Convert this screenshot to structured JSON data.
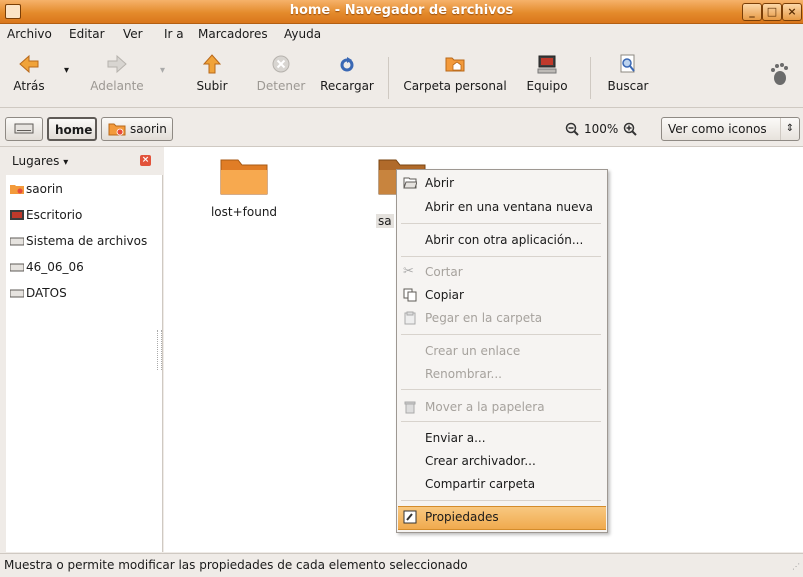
{
  "window": {
    "title": "home - Navegador de archivos"
  },
  "menubar": {
    "items": [
      {
        "label": "Archivo"
      },
      {
        "label": "Editar"
      },
      {
        "label": "Ver"
      },
      {
        "label": "Ir a"
      },
      {
        "label": "Marcadores"
      },
      {
        "label": "Ayuda"
      }
    ]
  },
  "toolbar": {
    "back": "Atrás",
    "forward": "Adelante",
    "up": "Subir",
    "stop": "Detener",
    "reload": "Recargar",
    "home": "Carpeta personal",
    "computer": "Equipo",
    "search": "Buscar"
  },
  "location": {
    "crumbs": [
      "home",
      "saorin"
    ],
    "zoom": "100%",
    "view_mode": "Ver como iconos"
  },
  "sidebar": {
    "header": "Lugares",
    "items": [
      {
        "label": "saorin",
        "icon": "home-folder-icon"
      },
      {
        "label": "Escritorio",
        "icon": "desktop-icon"
      },
      {
        "label": "Sistema de archivos",
        "icon": "drive-icon"
      },
      {
        "label": "46_06_06",
        "icon": "drive-icon"
      },
      {
        "label": "DATOS",
        "icon": "drive-icon"
      }
    ]
  },
  "files": [
    {
      "name": "lost+found"
    },
    {
      "name": "sa"
    }
  ],
  "context_menu": {
    "open": "Abrir",
    "open_new_window": "Abrir en una ventana nueva",
    "open_with": "Abrir con otra aplicación...",
    "cut": "Cortar",
    "copy": "Copiar",
    "paste": "Pegar en la carpeta",
    "make_link": "Crear un enlace",
    "rename": "Renombrar...",
    "trash": "Mover a la papelera",
    "send_to": "Enviar a...",
    "create_archive": "Crear archivador...",
    "share": "Compartir carpeta",
    "properties": "Propiedades"
  },
  "statusbar": {
    "text": "Muestra o permite modificar las propiedades de cada elemento seleccionado"
  },
  "colors": {
    "accent": "#e48b2c",
    "highlight": "#f0aa4e",
    "folder": "#f39a3b"
  }
}
